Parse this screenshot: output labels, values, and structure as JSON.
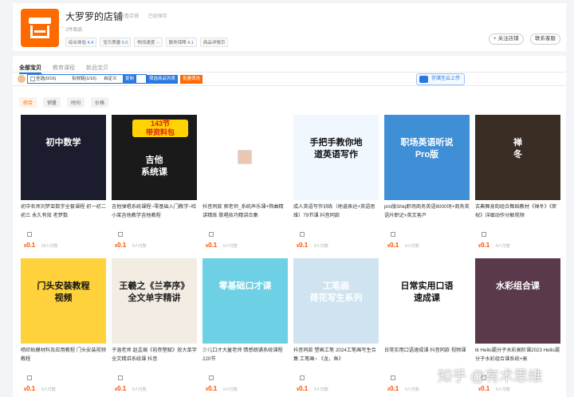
{
  "shop": {
    "name": "大罗罗的店铺",
    "meta": [
      "查看店铺",
      "已经保存"
    ],
    "count": "2件商品",
    "ratings": [
      {
        "label": "综合体验",
        "value": "4.4"
      },
      {
        "label": "宝贝质量",
        "value": "5.0"
      },
      {
        "label": "物流速度",
        "value": "--"
      },
      {
        "label": "服务保障",
        "value": "4.1"
      },
      {
        "label": "商品详情页",
        "value": ""
      }
    ],
    "follow_label": "+ 关注店铺",
    "contact_label": "联系客服"
  },
  "tabs": [
    "全部宝贝",
    "教育课程",
    "新品宝贝"
  ],
  "toolbar": {
    "select_all": "全选(0/16)",
    "valid_link": "有效链(1/16)",
    "custom": "自定义",
    "copy_label": "复制",
    "go_label": "筛选商品列表",
    "batch_label": "批量筛选",
    "cloud_label": "存储至云上传"
  },
  "sorts": [
    "综合",
    "销量",
    "时间",
    "价格"
  ],
  "products": [
    {
      "title": "初中名师刘梦亚数学全套课程 初一初二 初三 永久有效 老梦数",
      "price": "0.1",
      "sales": "16人付款",
      "thumb_text": "初中数学",
      "bg": "#1b1d2e",
      "fg": "#ffffff"
    },
    {
      "title": "吉他弹唱系统课程~零基础入门教学~哈小莱吉他教学吉他教程",
      "price": "0.1",
      "sales": "0人付款",
      "thumb_text": "吉他\n系统课",
      "badge": "143节\n带资料包",
      "bg": "#1a1a1a",
      "fg": "#ffffff"
    },
    {
      "title": "抖音同款 郭老师_系统声乐课+筛曲精讲精练 歌唱技巧精讲合集",
      "price": "0.1",
      "sales": "0人付款",
      "thumb_text": "",
      "bg": "#ffffff",
      "fg": "#333333"
    },
    {
      "title": "成人英语写作训练（地道表达+英语思维）79节课 抖音同款",
      "price": "0.1",
      "sales": "0人付款",
      "thumb_text": "手把手教你地\n道英语写作",
      "bg": "#f0f7ff",
      "fg": "#111111"
    },
    {
      "title": "pro版Shiq职场商务英语9000词+商务英语升职记+英文客户",
      "price": "0.1",
      "sales": "0人付款",
      "thumb_text": "职场英语听说\nPro版",
      "bg": "#3f8fd6",
      "fg": "#ffffff"
    },
    {
      "title": "古典舞身韵组合舞蹈教材《禅冬》《荣祝》详细动作分解视频",
      "price": "0.1",
      "sales": "0人付款",
      "thumb_text": "禅\n冬",
      "bg": "#3a2d24",
      "fg": "#ffffff"
    },
    {
      "title": "喷印贴膜材料及应用教程 门头安装视频教程",
      "price": "0.1",
      "sales": "0人付款",
      "thumb_text": "门头安装教程\n视频",
      "bg": "#ffd23c",
      "fg": "#111111"
    },
    {
      "title": "子涵老师 赵孟頫《前赤壁赋》放大单字全文精讲系统课 抖音",
      "price": "0.1",
      "sales": "0人付款",
      "thumb_text": "王羲之《兰亭序》\n全文单字精讲",
      "bg": "#f2ece2",
      "fg": "#222222"
    },
    {
      "title": "少儿口才大童老师 情感朗诵系统课程 220节",
      "price": "0.1",
      "sales": "0人付款",
      "thumb_text": "零基础口才课",
      "bg": "#6ed0e5",
      "fg": "#ffffff"
    },
    {
      "title": "抖音同款 塑画工笔 2024工笔画写生合集 工笔画~ 《龙，鱼》",
      "price": "0.1",
      "sales": "0人付款",
      "thumb_text": "工笔画\n荷花写生系列",
      "bg": "#cfe3f0",
      "fg": "#ffffff"
    },
    {
      "title": "日常实用口语速成课 抖音同款 视频课",
      "price": "0.1",
      "sales": "0人付款",
      "thumb_text": "日常实用口语\n速成课",
      "bg": "#ffffff",
      "fg": "#111111"
    },
    {
      "title": "tk Hello漏分子水彩高阶课2023 Hello漏分子水彩组合课系统+高",
      "price": "0.1",
      "sales": "0人付款",
      "thumb_text": "水彩组合课",
      "bg": "#5a3a4a",
      "fg": "#ffffff"
    }
  ],
  "watermark": "知乎 @有术思维"
}
